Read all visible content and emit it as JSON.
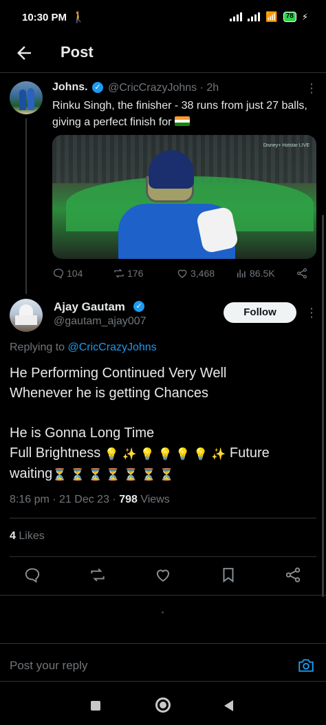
{
  "status": {
    "time": "10:30 PM",
    "walk_icon": "person-walking-icon",
    "battery": "78",
    "colors": {
      "battery": "#2fd04b"
    }
  },
  "header": {
    "title": "Post"
  },
  "quoted_post": {
    "name": "Johns.",
    "handle": "@CricCrazyJohns · 2h",
    "text": "Rinku Singh, the finisher - 38 runs from just 27 balls, giving a perfect finish for",
    "media_watermark": "Disney+ Hotstar LIVE",
    "stats": {
      "replies": "104",
      "reposts": "176",
      "likes": "3,468",
      "views": "86.5K"
    }
  },
  "reply_post": {
    "name": "Ajay Gautam",
    "handle": "@gautam_ajay007",
    "follow_label": "Follow",
    "replying_prefix": "Replying to",
    "replying_to": "@CricCrazyJohns",
    "lines": [
      "He Performing Continued Very Well",
      "Whenever he is getting Chances",
      "",
      "He is Gonna Long Time",
      "Full Brightness",
      "Future",
      "waiting"
    ],
    "meta_time": "8:16 pm · 21 Dec 23 ·",
    "meta_views": "798",
    "meta_views_label": "Views",
    "likes_count": "4",
    "likes_label": "Likes"
  },
  "reply_bar": {
    "placeholder": "Post your reply"
  },
  "colors": {
    "accent": "#1d9bf0",
    "text": "#e7e9ea",
    "muted": "#71767b",
    "divider": "#2f3336"
  }
}
